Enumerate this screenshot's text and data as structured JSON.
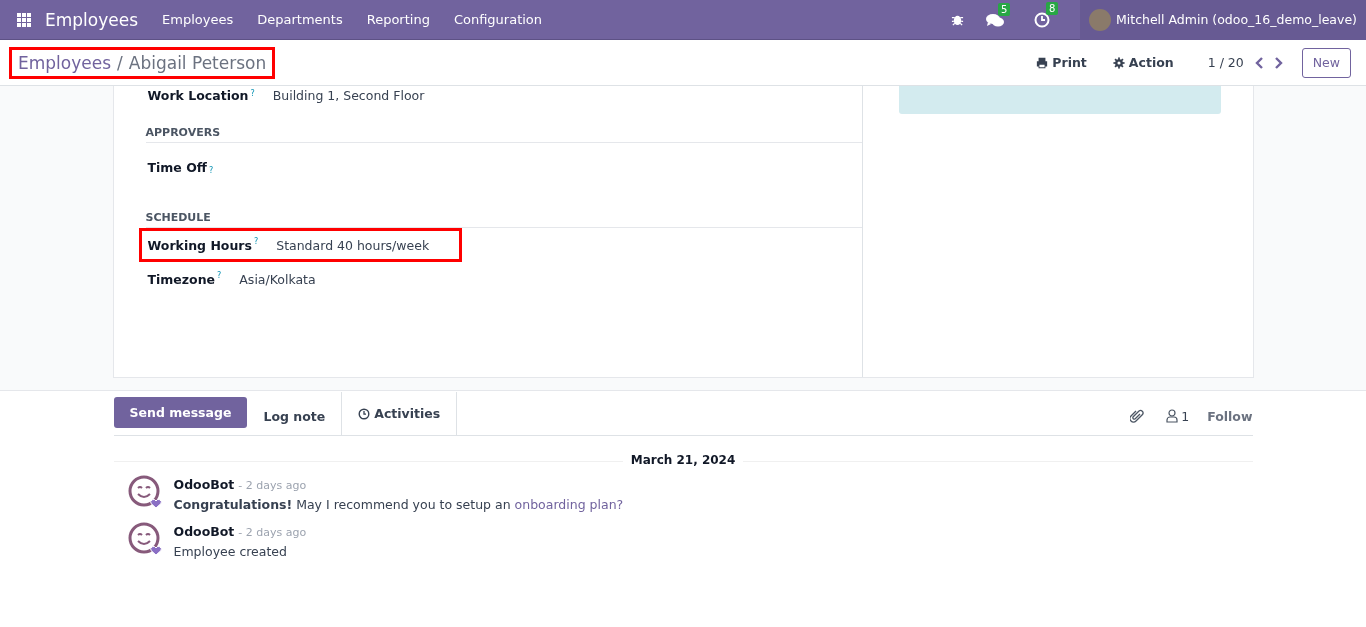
{
  "navbar": {
    "app_name": "Employees",
    "menus": [
      "Employees",
      "Departments",
      "Reporting",
      "Configuration"
    ],
    "messages_count": "5",
    "activities_count": "8",
    "user": "Mitchell Admin (odoo_16_demo_leave)"
  },
  "breadcrumb": {
    "parent": "Employees",
    "separator": "/",
    "current": "Abigail Peterson",
    "highlighted": true
  },
  "control_panel": {
    "print": "Print",
    "action": "Action",
    "pager": "1 / 20",
    "new": "New"
  },
  "form_groups": [
    {
      "fields": [
        {
          "label": "Work Location",
          "help": "?",
          "value": "Building 1, Second Floor",
          "highlighted": false
        }
      ]
    },
    {
      "title": "APPROVERS",
      "fields": [
        {
          "label": "Time Off",
          "help": "?",
          "highlighted": false
        }
      ]
    },
    {
      "title": "SCHEDULE",
      "fields": [
        {
          "label": "Working Hours",
          "help": "?",
          "value": "Standard 40 hours/week",
          "highlighted": true
        },
        {
          "label": "Timezone",
          "help": "?",
          "value": "Asia/Kolkata",
          "highlighted": false
        }
      ]
    }
  ],
  "chatter": {
    "tabs": [
      {
        "label": "Send message",
        "selected": true
      },
      {
        "label": "Log note",
        "selected": false
      },
      {
        "label": "Activities",
        "selected": false
      }
    ],
    "followers_count": "1",
    "follow": "Follow",
    "date": "March 21, 2024",
    "messages": [
      {
        "author": "OdooBot",
        "time": "- 2 days ago",
        "text": "**Congratulations!** May I recommend you to setup an",
        "link": "onboarding plan?"
      },
      {
        "author": "OdooBot",
        "time": "- 2 days ago",
        "text": "Employee created"
      }
    ]
  }
}
